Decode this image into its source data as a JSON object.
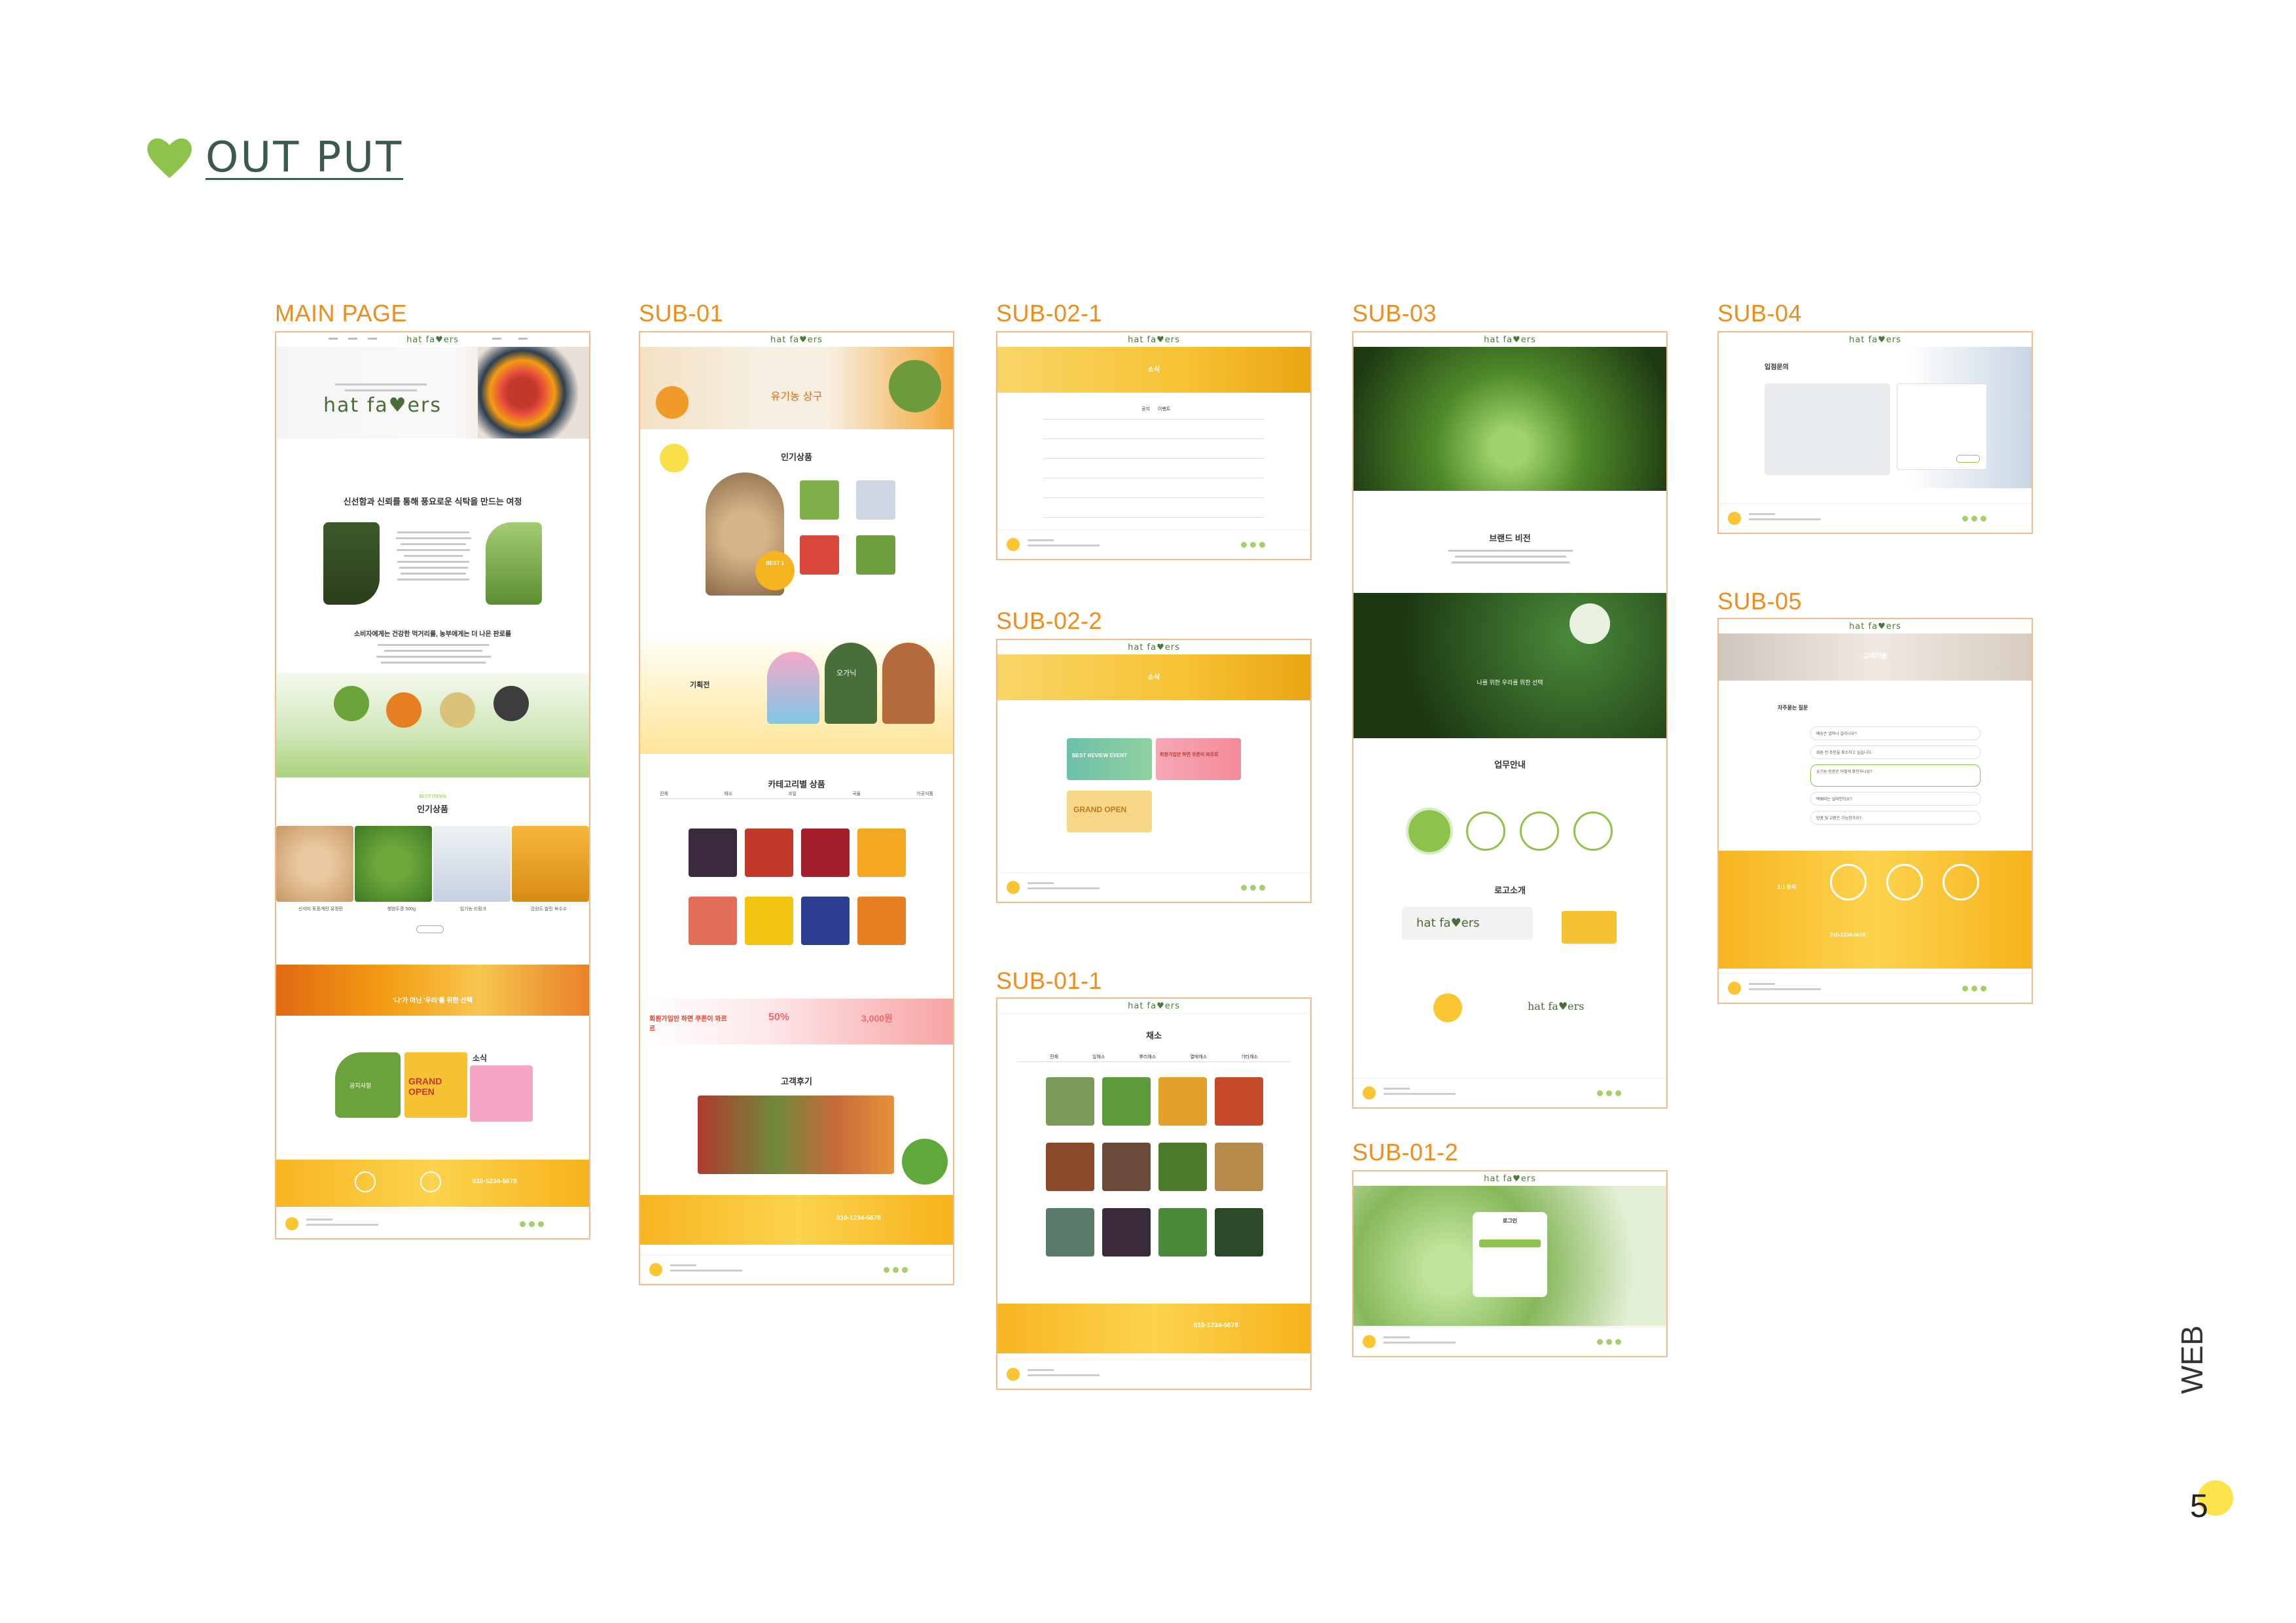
{
  "header": {
    "title": "OUT PUT",
    "icon": "heart-icon",
    "accent": "#8dc34a"
  },
  "panels": {
    "main": {
      "label": "MAIN PAGE",
      "logo": "hat fa♥ers",
      "hero_text": "hat fa♥ers",
      "section1_title": "신선함과 신뢰를 통해 풍요로운 식탁을 만드는 여정",
      "section2_title": "소비자에게는 건강한 먹거리를, 농부에게는 더 나은 판로를",
      "popular_title": "인기상품",
      "popular_tag": "BEST ITEMS",
      "popular_items": [
        "신석미 토종계란 유정란",
        "햇완두콩 500g",
        "임기농 드링크",
        "강원도 찰진 옥수수"
      ],
      "banner_text": "'나'가 아닌 '우리'를 위한 선택",
      "news_title": "소식",
      "news_tag1": "공지사항",
      "news_tag2": "GRAND OPEN",
      "phone": "010-5234-5678"
    },
    "sub01": {
      "label": "SUB-01",
      "hero_text": "유기농 상구",
      "popular_title": "인기상품",
      "best_badge": "BEST 1",
      "special_title": "기획전",
      "special_tag": "오가닉",
      "category_title": "카테고리별 상품",
      "tabs": [
        "전체",
        "채소",
        "과일",
        "곡물",
        "가공식품"
      ],
      "coupon_title": "회원가입만 하면 쿠폰이 와르르",
      "coupon_pct": "50%",
      "coupon_won": "3,000원",
      "review_title": "고객후기",
      "phone": "010-1234-5678"
    },
    "sub0201": {
      "label": "SUB-02-1",
      "banner_title": "소식",
      "tabs": [
        "공지",
        "이벤트"
      ]
    },
    "sub0202": {
      "label": "SUB-02-2",
      "banner_title": "소식",
      "event1": "BEST REVIEW EVENT",
      "event2": "회원가입만 하면 쿠폰이 와르르",
      "event3": "GRAND OPEN"
    },
    "sub0101": {
      "label": "SUB-01-1",
      "section_title": "채소",
      "tabs": [
        "전체",
        "잎채소",
        "뿌리채소",
        "열매채소",
        "기타채소"
      ],
      "phone": "010-1234-5678"
    },
    "sub03": {
      "label": "SUB-03",
      "brand_title": "브랜드 비전",
      "vision_sub": "나를 위한 우리를 위한 선택",
      "work_title": "업무안내",
      "logo_title": "로고소개",
      "logo_text": "hat fa♥ers",
      "logo_sub": "hat fa♥ers"
    },
    "sub0102": {
      "label": "SUB-01-2",
      "login_title": "로그인"
    },
    "sub04": {
      "label": "SUB-04",
      "title": "입점문의"
    },
    "sub05": {
      "label": "SUB-05",
      "banner_title": "고객지원",
      "faq_title": "자주묻는 질문",
      "faq_items": [
        "배송은 얼마나 걸리나요?",
        "회원 전 주문을 취소하고 싶습니다.",
        "유기농 인증은 어떻게 확인하나요?",
        "택배비는 얼마인가요?",
        "반품 및 교환은 가능한가요?"
      ],
      "inquiry_title": "1:1 문의",
      "phone": "010-1234-5678"
    }
  },
  "side": {
    "label": "WEB",
    "page": "5"
  }
}
